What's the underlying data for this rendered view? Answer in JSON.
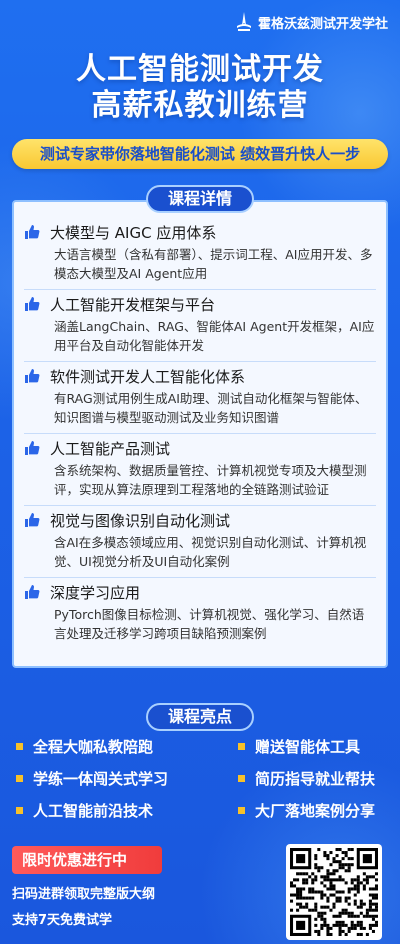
{
  "brand": {
    "name": "霍格沃兹测试开发学社",
    "icon": "compass-logo-icon"
  },
  "hero": {
    "line1": "人工智能测试开发",
    "line2": "高薪私教训练营"
  },
  "slogan": "测试专家带你落地智能化测试 绩效晋升快人一步",
  "details": {
    "heading": "课程详情",
    "courses": [
      {
        "title": "大模型与 AIGC 应用体系",
        "desc": "大语言模型（含私有部署）、提示词工程、AI应用开发、多模态大模型及AI Agent应用"
      },
      {
        "title": "人工智能开发框架与平台",
        "desc": "涵盖LangChain、RAG、智能体AI Agent开发框架，AI应用平台及自动化智能体开发"
      },
      {
        "title": "软件测试开发人工智能化体系",
        "desc": "有RAG测试用例生成AI助理、测试自动化框架与智能体、知识图谱与模型驱动测试及业务知识图谱"
      },
      {
        "title": "人工智能产品测试",
        "desc": "含系统架构、数据质量管控、计算机视觉专项及大模型测评，实现从算法原理到工程落地的全链路测试验证"
      },
      {
        "title": "视觉与图像识别自动化测试",
        "desc": "含AI在多模态领域应用、视觉识别自动化测试、计算机视觉、UI视觉分析及UI自动化案例"
      },
      {
        "title": "深度学习应用",
        "desc": "PyTorch图像目标检测、计算机视觉、强化学习、自然语言处理及迁移学习跨项目缺陷预测案例"
      }
    ]
  },
  "highlights": {
    "heading": "课程亮点",
    "items": [
      "全程大咖私教陪跑",
      "赠送智能体工具",
      "学练一体闯关式学习",
      "简历指导就业帮扶",
      "人工智能前沿技术",
      "大厂落地案例分享"
    ]
  },
  "promo": {
    "badge": "限时优惠进行中",
    "line1": "扫码进群领取完整版大纲",
    "line2": "支持7天免费试学",
    "qr_icon": "qr-code-icon"
  },
  "colors": {
    "background": "#1c63e8",
    "accent": "#f9c832",
    "promo": "#f03c3c"
  }
}
